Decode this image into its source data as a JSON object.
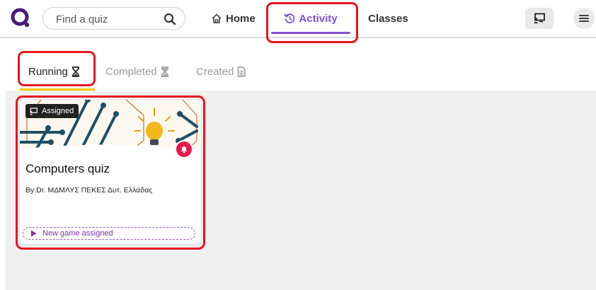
{
  "header": {
    "search_placeholder": "Find a quiz",
    "nav": {
      "home": "Home",
      "activity": "Activity",
      "classes": "Classes"
    },
    "accent_color": "#7e4fcf"
  },
  "tabs": [
    {
      "label": "Running",
      "icon": "hourglass-icon",
      "active": true
    },
    {
      "label": "Completed",
      "icon": "hourglass-icon",
      "active": false
    },
    {
      "label": "Created",
      "icon": "document-icon",
      "active": false
    }
  ],
  "card": {
    "badge": "Assigned",
    "title": "Computers quiz",
    "author": "By:Dr. ΜΔΜΛΥΣ ΠΕΚΕΣ Δυτ. Ελλάδας",
    "status": "New game assigned",
    "notification_color": "#e6194b"
  },
  "highlight_color": "#e8141f"
}
